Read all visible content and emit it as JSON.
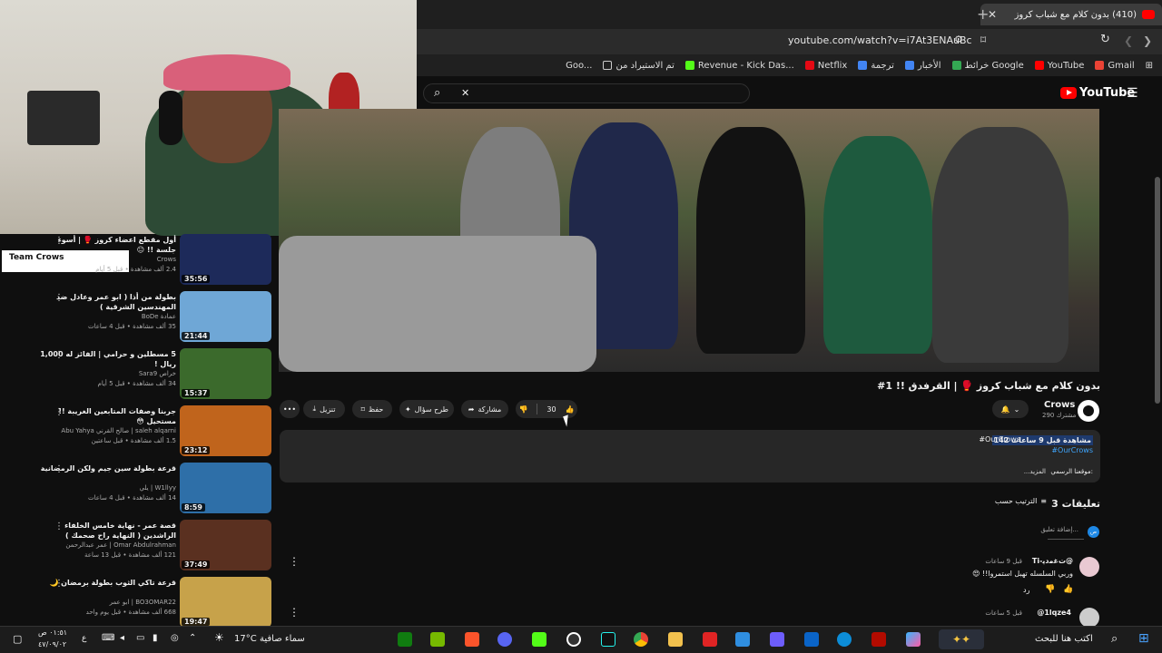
{
  "browser": {
    "tab_title": "(410) بدون كلام مع شباب كروز",
    "url": "youtube.com/watch?v=i7At3ENAuBc",
    "bookmarks": [
      "Gmail",
      "YouTube",
      "خرائط Google",
      "الأخبار",
      "ترجمة",
      "Netflix",
      "Revenue - Kick Das...",
      "تم الاستيراد من",
      "Goo..."
    ]
  },
  "youtube": {
    "logo": "YouTube",
    "search_value": ""
  },
  "overlay": {
    "team_label": "Team Crows"
  },
  "video": {
    "title": "بدون كلام مع شباب كروز 🥊 | القرفدق !! 1#",
    "channel": "Crows",
    "subs": "290 مشترك",
    "likes": "30",
    "actions": {
      "share": "مشاركة",
      "ask": "طرح سؤال",
      "save": "حفظ",
      "download": "تنزيل"
    },
    "views_line": "142 مشاهدة قبل 9 ساعات",
    "tag": "#OurCrows",
    "tag2": "#OurCrows",
    "website": "موقعنا الرسمي:",
    "more": "...المزيد"
  },
  "comments": {
    "count": "3 تعليقات",
    "sort": "الترتيب حسب",
    "add": "إضافة تعليق...",
    "items": [
      {
        "author": "@ﺕﻏﻣﺩﻳ-Ti",
        "time": "قبل 9 ساعات",
        "text": "وربي السلسله تهبل استمروا!! 😍"
      },
      {
        "author": "@1lqze4",
        "time": "قبل 5 ساعات",
        "text": ""
      }
    ]
  },
  "sidebar": [
    {
      "title": "أول مقطع اعضاء كروز 🥊 | أسوء جلسة !! 😐",
      "channel": "Crows",
      "meta": "2.4 ألف مشاهدة • قبل 5 أيام",
      "duration": "35:56",
      "color": "#1d2a5a"
    },
    {
      "title": "بطولة من أذا ( ابو عمر وعادل ضد المهندسين الشرقية )",
      "channel": "عمادة BoDe",
      "meta": "35 ألف مشاهدة • قبل 4 ساعات",
      "duration": "21:44",
      "color": "#6fa7d6"
    },
    {
      "title": "5 مسطلين و حرامي | الفائز له 1,000 ريال !",
      "channel": "خراص Sara9",
      "meta": "34 ألف مشاهدة • قبل 5 أيام",
      "duration": "15:37",
      "color": "#3b6a2c"
    },
    {
      "title": "جربنا وصفات المتابعين الغريبة !! مستحيل 😳",
      "channel": "saleh alqarni | صالح القرني Abu Yahya",
      "meta": "1.5 ألف مشاهدة • قبل ساعتين",
      "duration": "23:12",
      "color": "#c0641c"
    },
    {
      "title": "قرعة بطولة سين جيم ولكن الرمضانية",
      "channel": "W1llyy | يلي",
      "meta": "14 ألف مشاهدة • قبل 4 ساعات",
      "duration": "8:59",
      "color": "#2e6fa8"
    },
    {
      "title": "قصة عمر - نهاية خامس الخلفاء الراشدين ( النهاية راح صحمك )",
      "channel": "Omar Abdulrahman | عمر عبدالرحمن",
      "meta": "121 ألف مشاهدة • قبل 13 ساعة",
      "duration": "37:49",
      "color": "#5a3020"
    },
    {
      "title": "قرعة تاكي الثوب بطولة برمضان 🌙",
      "channel": "BO3OMAR22 | ابو عمر",
      "meta": "668 ألف مشاهدة • قبل يوم واحد",
      "duration": "19:47",
      "color": "#c7a24a"
    }
  ],
  "taskbar": {
    "search": "اكتب هنا للبحث",
    "weather": "سماء صافية",
    "temp": "17°C",
    "time": "٠١:٥١ ص",
    "date": "٤٧/٠٩/٠٢"
  }
}
